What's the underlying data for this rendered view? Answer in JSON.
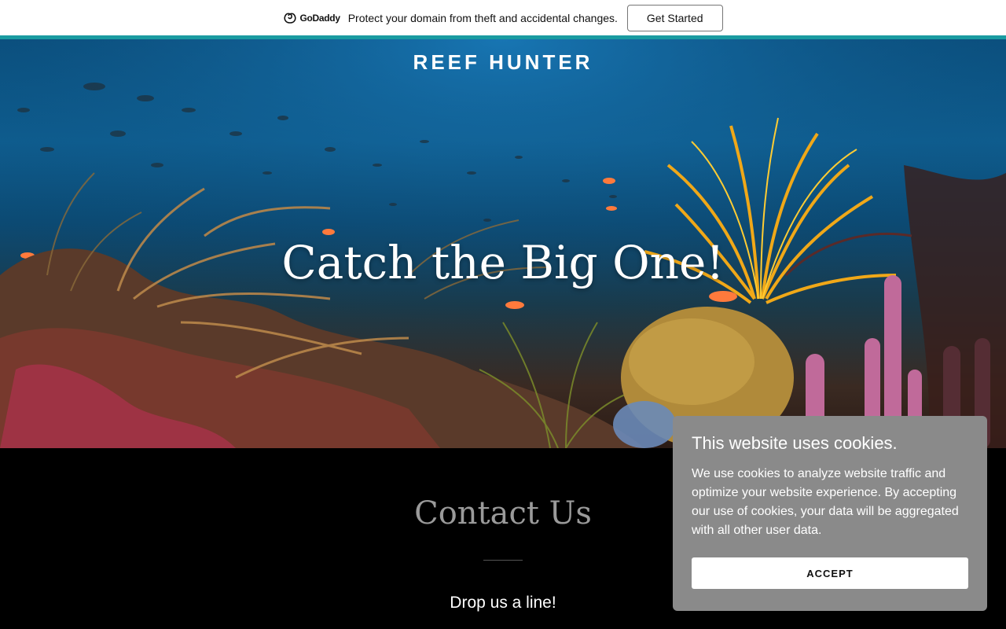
{
  "promo_bar": {
    "logo_text": "GoDaddy",
    "message": "Protect your domain from theft and accidental changes.",
    "cta_label": "Get Started",
    "accent_color": "#1a9ba1"
  },
  "header": {
    "site_title": "REEF HUNTER"
  },
  "hero": {
    "headline": "Catch the Big One!"
  },
  "contact": {
    "title": "Contact Us",
    "subtitle": "Drop us a line!"
  },
  "cookie_banner": {
    "title": "This website uses cookies.",
    "body": "We use cookies to analyze website traffic and optimize your website experience. By accepting our use of cookies, your data will be aggregated with all other user data.",
    "accept_label": "ACCEPT",
    "background_color": "#8a8a8a"
  }
}
